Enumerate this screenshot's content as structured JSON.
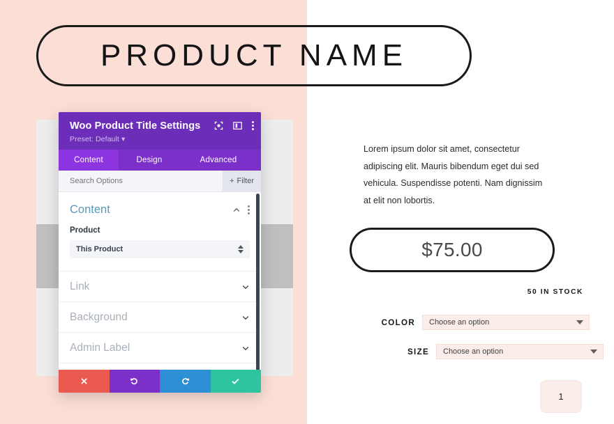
{
  "product": {
    "title": "PRODUCT NAME",
    "description": "Lorem ipsum dolor sit amet, consectetur adipiscing elit. Mauris bibendum eget dui sed vehicula. Suspendisse potenti. Nam dignissim at elit non lobortis.",
    "price": "$75.00",
    "stock": "50 IN STOCK",
    "quantity": "1",
    "attributes": [
      {
        "label": "COLOR",
        "value": "Choose an option"
      },
      {
        "label": "SIZE",
        "value": "Choose an option"
      }
    ]
  },
  "settings_modal": {
    "title": "Woo Product Title Settings",
    "preset": "Preset: Default ▾",
    "header_icons": [
      "focus-icon",
      "layout-icon",
      "more-vertical-icon"
    ],
    "tabs": [
      {
        "label": "Content",
        "active": true
      },
      {
        "label": "Design",
        "active": false
      },
      {
        "label": "Advanced",
        "active": false
      }
    ],
    "search": {
      "placeholder": "Search Options",
      "filter_label": "Filter"
    },
    "open_section": {
      "title": "Content",
      "field_label": "Product",
      "field_value": "This Product"
    },
    "closed_sections": [
      {
        "title": "Link"
      },
      {
        "title": "Background"
      },
      {
        "title": "Admin Label"
      }
    ],
    "actions": [
      {
        "name": "cancel",
        "icon": "close-icon",
        "color": "#eb5a4e"
      },
      {
        "name": "undo",
        "icon": "undo-icon",
        "color": "#7b30c9"
      },
      {
        "name": "redo",
        "icon": "redo-icon",
        "color": "#2d8fd5"
      },
      {
        "name": "save",
        "icon": "check-icon",
        "color": "#2ec4a0"
      }
    ]
  },
  "colors": {
    "pink_background": "#fbdfd6",
    "modal_header": "#6c2eb9",
    "modal_tabs": "#7b30c9",
    "tab_active": "#8c35e0",
    "section_title": "#5a99b8",
    "attribute_select_bg": "#fbeeea"
  }
}
